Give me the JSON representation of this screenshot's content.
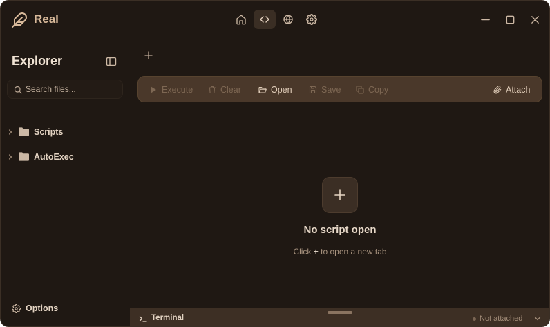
{
  "app": {
    "title": "Real",
    "logo_icon": "feather-logo-icon"
  },
  "nav": {
    "items": [
      {
        "icon": "home-icon",
        "active": false
      },
      {
        "icon": "code-icon",
        "active": true
      },
      {
        "icon": "globe-icon",
        "active": false
      },
      {
        "icon": "gear-icon",
        "active": false
      }
    ]
  },
  "window_controls": [
    "minimize-icon",
    "maximize-icon",
    "close-icon"
  ],
  "sidebar": {
    "title": "Explorer",
    "search_placeholder": "Search files...",
    "folders": [
      {
        "label": "Scripts"
      },
      {
        "label": "AutoExec"
      }
    ],
    "options_label": "Options"
  },
  "toolbar": {
    "execute": "Execute",
    "clear": "Clear",
    "open": "Open",
    "save": "Save",
    "copy": "Copy",
    "attach": "Attach"
  },
  "empty_state": {
    "title": "No script open",
    "hint_before": "Click",
    "hint_symbol": "+",
    "hint_after": "to open a new tab"
  },
  "terminal": {
    "label": "Terminal",
    "status": "Not attached"
  },
  "colors": {
    "background": "#1f1813",
    "toolbar": "#4a382a",
    "accent": "#d8b99a",
    "terminal_bar": "#3d2f24"
  }
}
